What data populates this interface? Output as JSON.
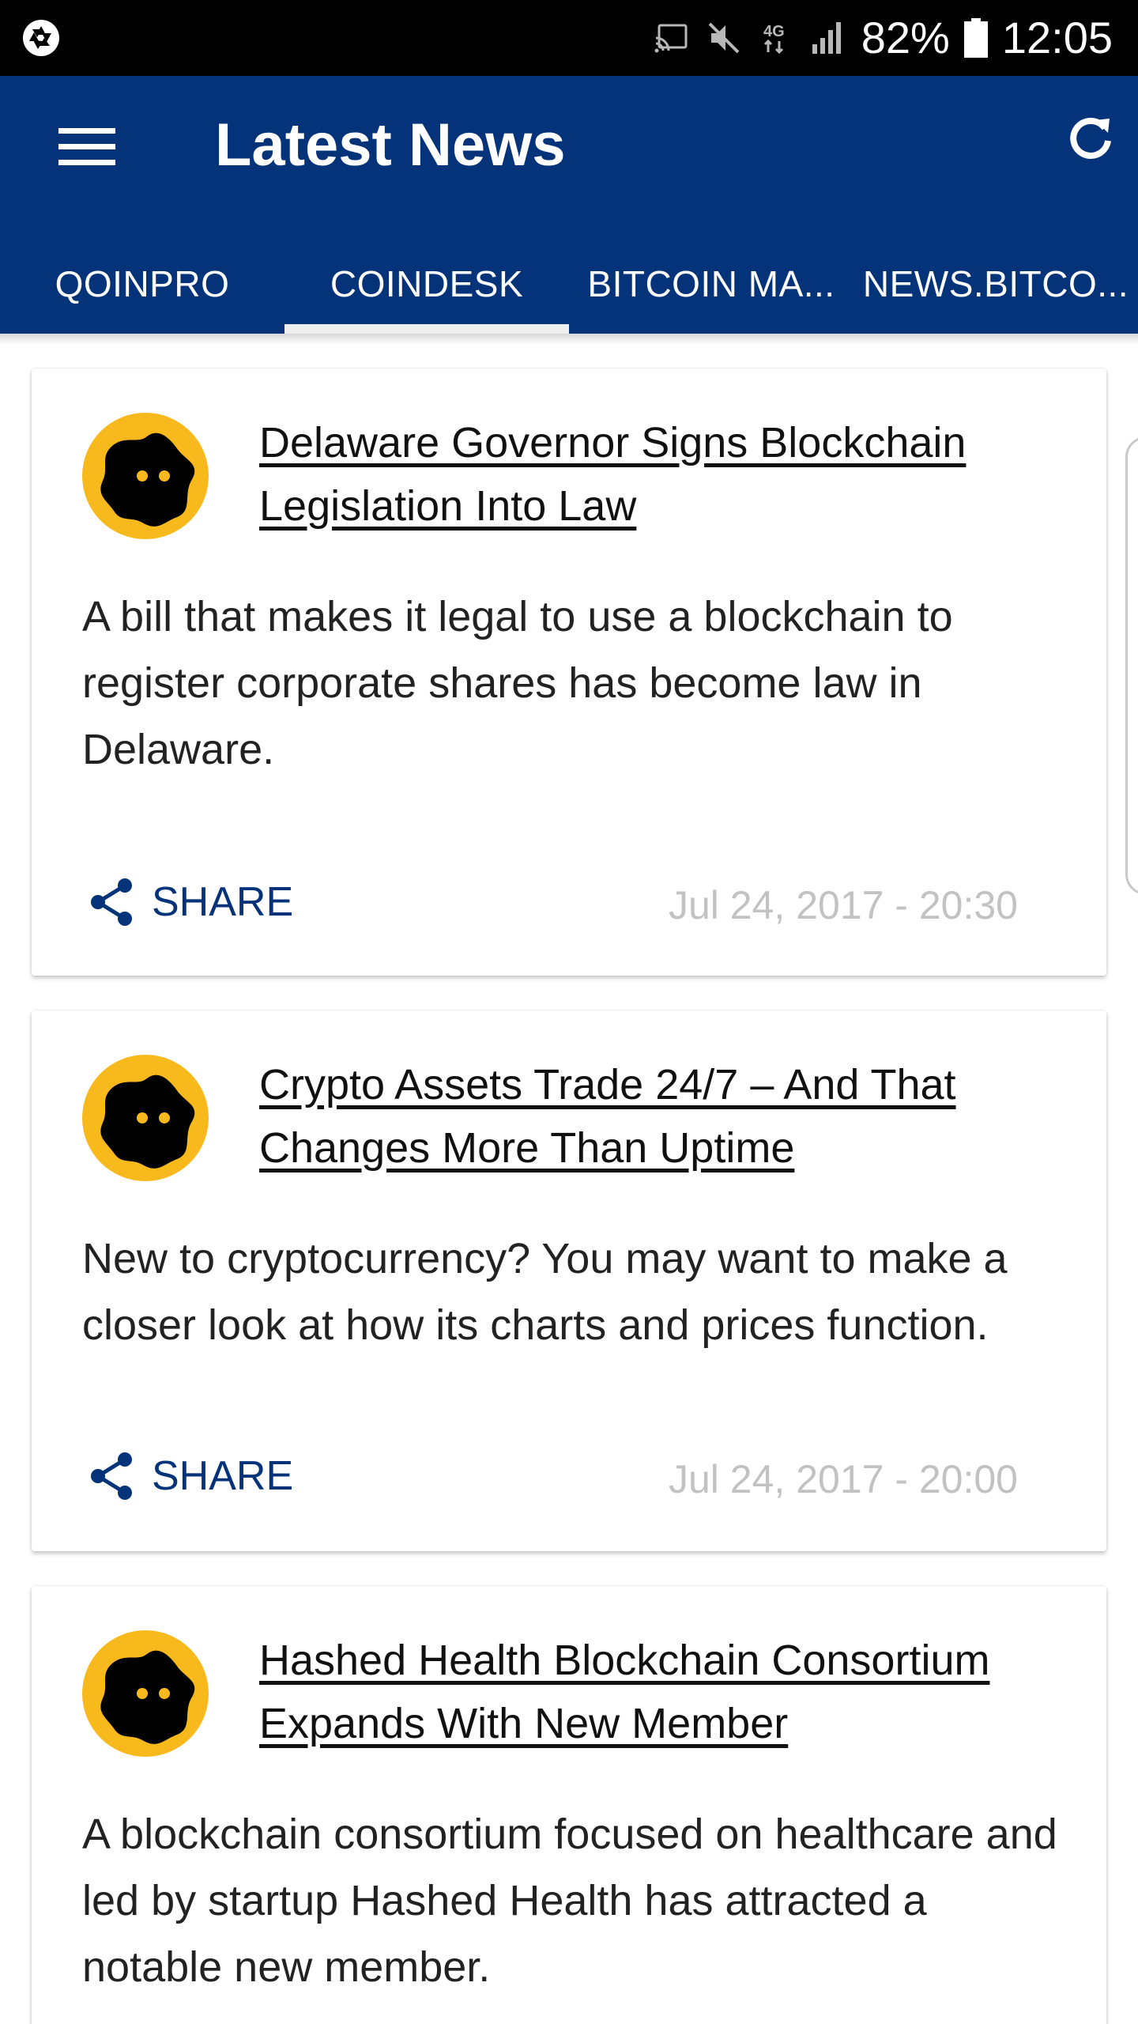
{
  "status_bar": {
    "network": "4G",
    "battery": "82%",
    "time": "12:05",
    "icons": [
      "aperture-icon",
      "cast-icon",
      "mute-icon",
      "network-4g-icon",
      "signal-icon",
      "battery-icon"
    ]
  },
  "app_bar": {
    "title": "Latest News",
    "menu_icon": "hamburger-menu-icon",
    "refresh_icon": "refresh-icon",
    "background": "#04337a"
  },
  "tabs": [
    {
      "label": "QOINPRO",
      "selected": false
    },
    {
      "label": "COINDESK",
      "selected": true
    },
    {
      "label": "BITCOIN MA...",
      "selected": false
    },
    {
      "label": "NEWS.BITCO...",
      "selected": false
    }
  ],
  "articles": [
    {
      "title": "Delaware Governor Signs Blockchain Legislation Into Law",
      "summary": "A bill that makes it legal to use a blockchain to register corporate shares has become law in Delaware.",
      "share_label": "SHARE",
      "date": "Jul 24, 2017 - 20:30"
    },
    {
      "title": "Crypto Assets Trade 24/7 – And That Changes More Than Uptime",
      "summary": "New to cryptocurrency? You may want to make a closer look at how its charts and prices function.",
      "share_label": "SHARE",
      "date": "Jul 24, 2017 - 20:00"
    },
    {
      "title": "Hashed Health Blockchain Consortium Expands With New Member",
      "summary": "A blockchain consortium focused on healthcare and led by startup Hashed Health has attracted a notable new member."
    }
  ],
  "colors": {
    "brand": "#04337a",
    "logo_yellow": "#f7b91b",
    "date_gray": "#c2c2c2"
  }
}
